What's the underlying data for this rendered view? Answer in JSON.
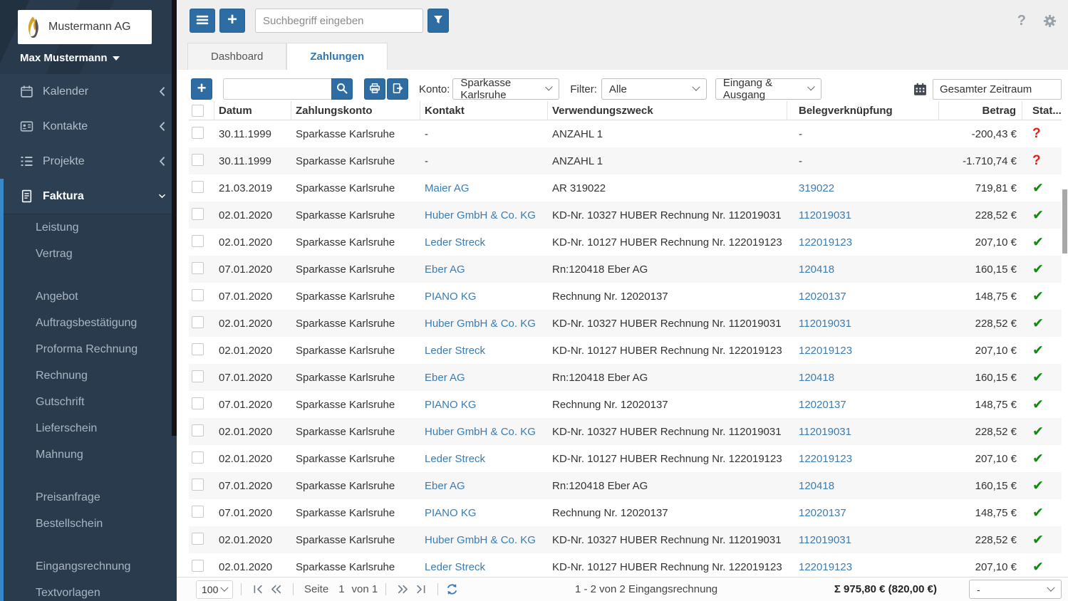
{
  "colors": {
    "accent_blue": "#2e6da4",
    "link_blue": "#3a7cb1",
    "sidebar_bg": "#2d3f52",
    "stripe_blue": "#3688c8",
    "success_green": "#0e8c0e",
    "error_red": "#e01d1d"
  },
  "sidebar": {
    "logo_text": "Mustermann AG",
    "logo_icon": "flame-icon",
    "user_name": "Max Mustermann",
    "items": [
      {
        "label": "Kalender",
        "icon": "calendar-icon",
        "expanded": false
      },
      {
        "label": "Kontakte",
        "icon": "contacts-icon",
        "expanded": false
      },
      {
        "label": "Projekte",
        "icon": "projects-icon",
        "expanded": false
      },
      {
        "label": "Faktura",
        "icon": "document-icon",
        "expanded": true
      }
    ],
    "submenu_groups": [
      [
        "Leistung",
        "Vertrag"
      ],
      [
        "Angebot",
        "Auftragsbestätigung",
        "Proforma Rechnung",
        "Rechnung",
        "Gutschrift",
        "Lieferschein",
        "Mahnung"
      ],
      [
        "Preisanfrage",
        "Bestellschein"
      ],
      [
        "Eingangsrechnung",
        "Textvorlagen"
      ]
    ]
  },
  "topbar": {
    "search_placeholder": "Suchbegriff eingeben",
    "icons": [
      "menu-icon",
      "plus-icon",
      "filter-funnel-icon",
      "help-icon",
      "gear-icon"
    ],
    "help_glyph": "?"
  },
  "tabs": [
    {
      "label": "Dashboard",
      "active": false
    },
    {
      "label": "Zahlungen",
      "active": true
    }
  ],
  "toolbar": {
    "konto_label": "Konto:",
    "konto_value": "Sparkasse Karlsruhe",
    "filter_label": "Filter:",
    "filter_value": "Alle",
    "direction_value": "Eingang & Ausgang",
    "zeitraum_value": "Gesamter Zeitraum",
    "icons": [
      "plus-icon",
      "search-icon",
      "print-icon",
      "export-icon",
      "calendar-icon"
    ]
  },
  "table": {
    "columns": [
      "",
      "Datum",
      "Zahlungskonto",
      "Kontakt",
      "Verwendungszweck",
      "Belegverknüpfung",
      "Betrag",
      "Stat..."
    ],
    "status_glyphs": {
      "check": "✔",
      "question": "?"
    },
    "rows": [
      {
        "datum": "30.11.1999",
        "konto": "Sparkasse Karlsruhe",
        "kontakt": "-",
        "zweck": "ANZAHL 1",
        "beleg": "-",
        "betrag": "-200,43 €",
        "status": "question"
      },
      {
        "datum": "30.11.1999",
        "konto": "Sparkasse Karlsruhe",
        "kontakt": "-",
        "zweck": "ANZAHL 1",
        "beleg": "-",
        "betrag": "-1.710,74 €",
        "status": "question"
      },
      {
        "datum": "21.03.2019",
        "konto": "Sparkasse Karlsruhe",
        "kontakt": "Maier AG",
        "zweck": "AR 319022",
        "beleg": "319022",
        "betrag": "719,81 €",
        "status": "check"
      },
      {
        "datum": "02.01.2020",
        "konto": "Sparkasse Karlsruhe",
        "kontakt": "Huber GmbH & Co. KG",
        "zweck": "KD-Nr. 10327 HUBER Rechnung Nr. 112019031",
        "beleg": "112019031",
        "betrag": "228,52 €",
        "status": "check"
      },
      {
        "datum": "02.01.2020",
        "konto": "Sparkasse Karlsruhe",
        "kontakt": "Leder Streck",
        "zweck": "KD-Nr. 10127 HUBER Rechnung Nr. 122019123",
        "beleg": "122019123",
        "betrag": "207,10 €",
        "status": "check"
      },
      {
        "datum": "07.01.2020",
        "konto": "Sparkasse Karlsruhe",
        "kontakt": "Eber AG",
        "zweck": "Rn:120418 Eber AG",
        "beleg": "120418",
        "betrag": "160,15 €",
        "status": "check"
      },
      {
        "datum": "07.01.2020",
        "konto": "Sparkasse Karlsruhe",
        "kontakt": "PIANO KG",
        "zweck": "Rechnung Nr. 12020137",
        "beleg": "12020137",
        "betrag": "148,75 €",
        "status": "check"
      },
      {
        "datum": "02.01.2020",
        "konto": "Sparkasse Karlsruhe",
        "kontakt": "Huber GmbH & Co. KG",
        "zweck": "KD-Nr. 10327 HUBER Rechnung Nr. 112019031",
        "beleg": "112019031",
        "betrag": "228,52 €",
        "status": "check"
      },
      {
        "datum": "02.01.2020",
        "konto": "Sparkasse Karlsruhe",
        "kontakt": "Leder Streck",
        "zweck": "KD-Nr. 10127 HUBER Rechnung Nr. 122019123",
        "beleg": "122019123",
        "betrag": "207,10 €",
        "status": "check"
      },
      {
        "datum": "07.01.2020",
        "konto": "Sparkasse Karlsruhe",
        "kontakt": "Eber AG",
        "zweck": "Rn:120418 Eber AG",
        "beleg": "120418",
        "betrag": "160,15 €",
        "status": "check"
      },
      {
        "datum": "07.01.2020",
        "konto": "Sparkasse Karlsruhe",
        "kontakt": "PIANO KG",
        "zweck": "Rechnung Nr. 12020137",
        "beleg": "12020137",
        "betrag": "148,75 €",
        "status": "check"
      },
      {
        "datum": "02.01.2020",
        "konto": "Sparkasse Karlsruhe",
        "kontakt": "Huber GmbH & Co. KG",
        "zweck": "KD-Nr. 10327 HUBER Rechnung Nr. 112019031",
        "beleg": "112019031",
        "betrag": "228,52 €",
        "status": "check"
      },
      {
        "datum": "02.01.2020",
        "konto": "Sparkasse Karlsruhe",
        "kontakt": "Leder Streck",
        "zweck": "KD-Nr. 10127 HUBER Rechnung Nr. 122019123",
        "beleg": "122019123",
        "betrag": "207,10 €",
        "status": "check"
      },
      {
        "datum": "07.01.2020",
        "konto": "Sparkasse Karlsruhe",
        "kontakt": "Eber AG",
        "zweck": "Rn:120418 Eber AG",
        "beleg": "120418",
        "betrag": "160,15 €",
        "status": "check"
      },
      {
        "datum": "07.01.2020",
        "konto": "Sparkasse Karlsruhe",
        "kontakt": "PIANO KG",
        "zweck": "Rechnung Nr. 12020137",
        "beleg": "12020137",
        "betrag": "148,75 €",
        "status": "check"
      },
      {
        "datum": "02.01.2020",
        "konto": "Sparkasse Karlsruhe",
        "kontakt": "Huber GmbH & Co. KG",
        "zweck": "KD-Nr. 10327 HUBER Rechnung Nr. 112019031",
        "beleg": "112019031",
        "betrag": "228,52 €",
        "status": "check"
      },
      {
        "datum": "02.01.2020",
        "konto": "Sparkasse Karlsruhe",
        "kontakt": "Leder Streck",
        "zweck": "KD-Nr. 10127 HUBER Rechnung Nr. 122019123",
        "beleg": "122019123",
        "betrag": "207,10 €",
        "status": "check"
      }
    ]
  },
  "footer": {
    "page_size": "100",
    "seite_label": "Seite",
    "page_current": "1",
    "page_of": "von 1",
    "range_text": "1 - 2 von 2 Eingangsrechnung",
    "sum_text": "Σ 975,80 € (820,00 €)",
    "extra_select_value": "-",
    "icons": [
      "first-page-icon",
      "prev-page-icon",
      "next-page-icon",
      "last-page-icon",
      "refresh-icon"
    ]
  }
}
